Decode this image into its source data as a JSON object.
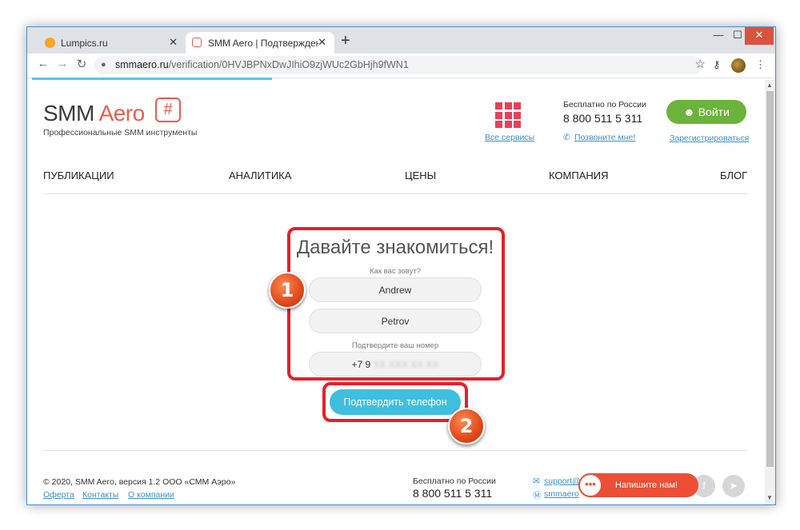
{
  "browser": {
    "tabs": [
      {
        "title": "Lumpics.ru",
        "close": "✕"
      },
      {
        "title": "SMM Aero | Подтверждение данных",
        "close": "✕"
      }
    ],
    "new_tab": "+",
    "window_controls": {
      "minimize": "—",
      "maximize": "☐",
      "close": "✕"
    },
    "nav": {
      "back": "←",
      "forward": "→",
      "reload": "↻"
    },
    "url_domain": "smmaero.ru",
    "url_path": "/verification/0HVJBPNxDwJIhiO9zjWUc2GbHjh9fWN1",
    "icons": {
      "star": "☆",
      "key": "⚷",
      "menu": "⋮",
      "lock": "🔒"
    }
  },
  "header": {
    "logo_smm": "SMM ",
    "logo_aero": "Aero",
    "logo_badge": "#",
    "tagline": "Профессиональные SMM инструменты",
    "all_services": "Все сервисы",
    "phone_label": "Бесплатно по России",
    "phone": "8 800 511 5 311",
    "call_me": "Позвоните мне!",
    "login": "Войти",
    "register": "Зарегистрироваться"
  },
  "nav": [
    "ПУБЛИКАЦИИ",
    "АНАЛИТИКА",
    "ЦЕНЫ",
    "КОМПАНИЯ",
    "БЛОГ"
  ],
  "form": {
    "title": "Давайте знакомиться!",
    "name_label": "Как вас зовут?",
    "first_name": "Andrew",
    "last_name": "Petrov",
    "phone_label": "Подтвердите ваш номер",
    "phone_prefix": "+7 9",
    "phone_hidden": "XX XXX XX XX",
    "confirm_button": "Подтвердить телефон"
  },
  "annotations": {
    "step1": "1",
    "step2": "2",
    "color": "#e5202a"
  },
  "footer": {
    "copyright": "© 2020, SMM Aero, версия 1.2 ООО «СММ Аэро»",
    "links": [
      "Оферта",
      "Контакты",
      "О компании"
    ],
    "phone_label": "Бесплатно по России",
    "phone": "8 800 511 5 311",
    "email": "support@",
    "skype": "smmaero"
  },
  "chat": {
    "label": "Напишите нам!",
    "icon": "•••"
  },
  "social": {
    "facebook": "f",
    "telegram": "➤"
  }
}
